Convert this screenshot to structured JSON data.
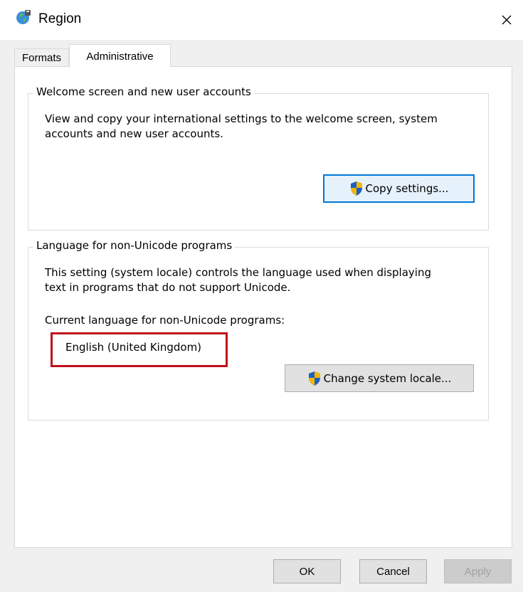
{
  "window": {
    "title": "Region",
    "app_icon": "globe-icon",
    "close_glyph": "✕"
  },
  "tabs": [
    {
      "label": "Formats",
      "active": false
    },
    {
      "label": "Administrative",
      "active": true
    }
  ],
  "welcome_group": {
    "legend": "Welcome screen and new user accounts",
    "description_line1": "View and copy your international settings to the welcome screen, system",
    "description_line2": "accounts and new user accounts.",
    "button_label": "Copy settings..."
  },
  "language_group": {
    "legend": "Language for non-Unicode programs",
    "description_line1": "This setting (system locale) controls the language used when displaying",
    "description_line2": "text in programs that do not support Unicode.",
    "current_label": "Current language for non-Unicode programs:",
    "current_value": "English (United Kingdom)",
    "button_label": "Change system locale..."
  },
  "footer": {
    "ok_label": "OK",
    "cancel_label": "Cancel",
    "apply_label": "Apply"
  },
  "colors": {
    "accent": "#0078d7",
    "highlight": "#c0101c",
    "shield_blue": "#1f5fbf",
    "shield_yellow": "#f2b705"
  }
}
